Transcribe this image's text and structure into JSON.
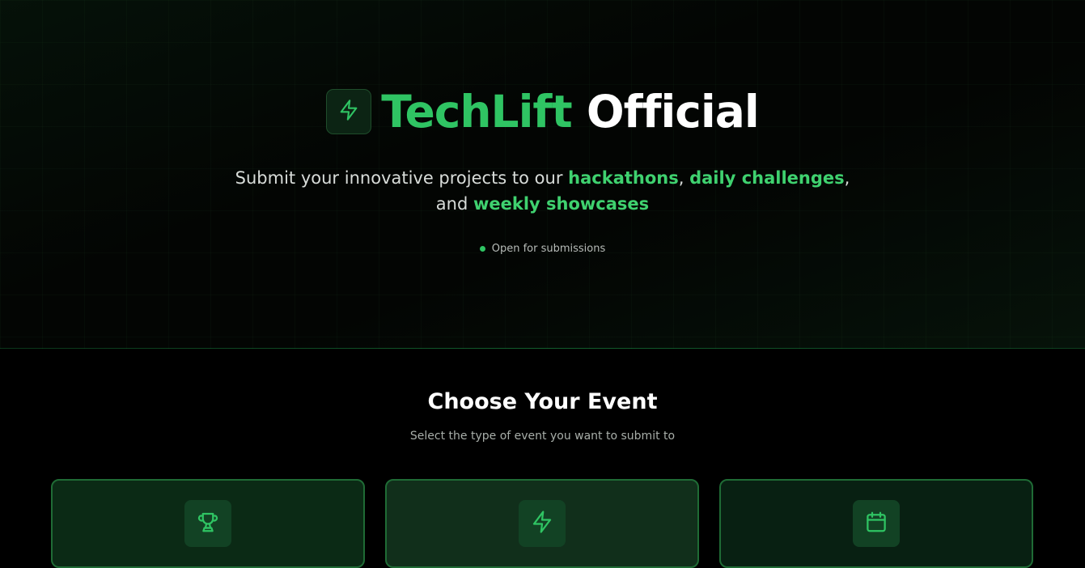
{
  "hero": {
    "logo_icon": "lightning-bolt-icon",
    "title_brand": "TechLift",
    "title_rest": "Official",
    "subtitle": {
      "part1": "Submit your innovative projects to our ",
      "highlight1": "hackathons",
      "sep1": ", ",
      "highlight2": "daily challenges",
      "sep2": ",",
      "part2": "and ",
      "highlight3": "weekly showcases"
    },
    "status_text": "Open for submissions"
  },
  "events": {
    "title": "Choose Your Event",
    "subtitle": "Select the type of event you want to submit to",
    "cards": [
      {
        "icon": "trophy-icon"
      },
      {
        "icon": "lightning-bolt-icon"
      },
      {
        "icon": "calendar-icon"
      }
    ]
  },
  "colors": {
    "accent": "#2fc463",
    "highlight": "#3fd16f",
    "background": "#000000",
    "card_border": "#1f6b35"
  }
}
